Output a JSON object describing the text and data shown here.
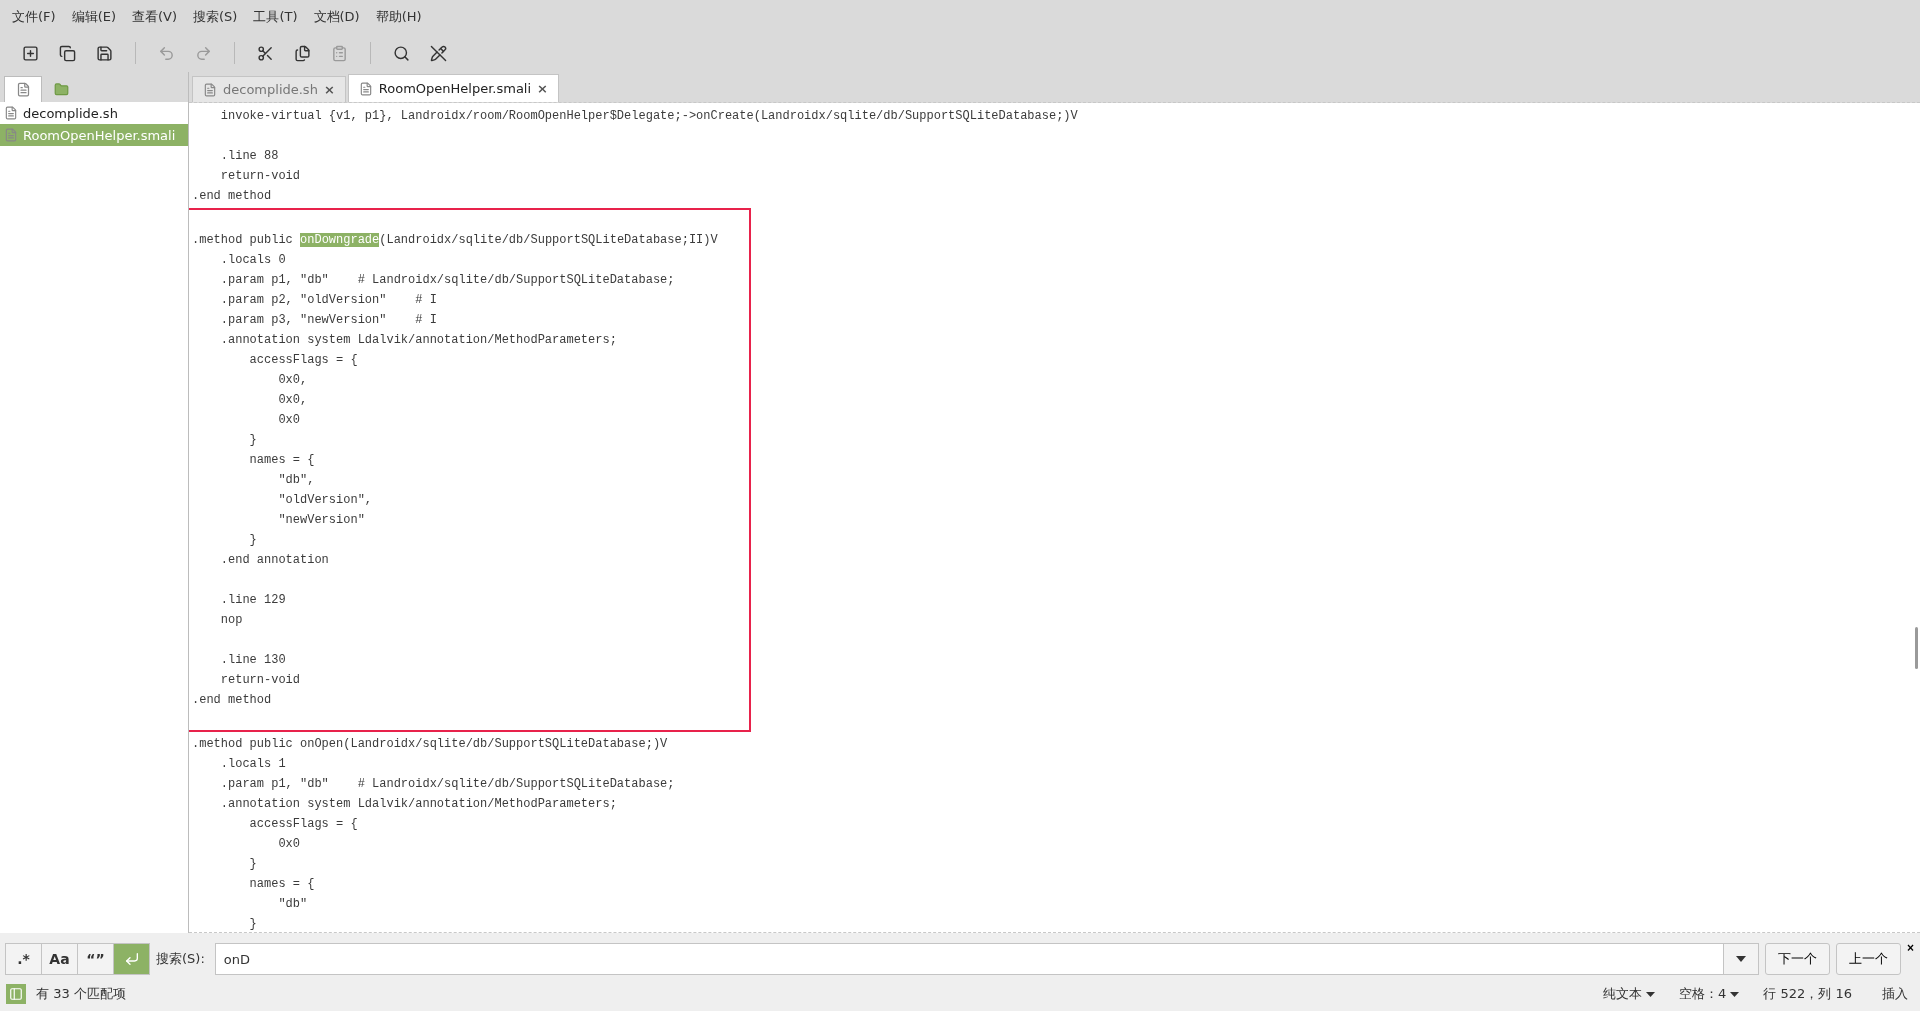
{
  "menu": [
    "文件(F)",
    "编辑(E)",
    "查看(V)",
    "搜索(S)",
    "工具(T)",
    "文档(D)",
    "帮助(H)"
  ],
  "toolbar": [
    {
      "kind": "new",
      "disabled": false
    },
    {
      "kind": "duplicate",
      "disabled": false
    },
    {
      "kind": "save",
      "disabled": false
    },
    {
      "kind": "separator"
    },
    {
      "kind": "undo",
      "disabled": true
    },
    {
      "kind": "redo",
      "disabled": true
    },
    {
      "kind": "separator"
    },
    {
      "kind": "cut",
      "disabled": false
    },
    {
      "kind": "copy",
      "disabled": false
    },
    {
      "kind": "paste",
      "disabled": true
    },
    {
      "kind": "separator"
    },
    {
      "kind": "search",
      "disabled": false
    },
    {
      "kind": "replace",
      "disabled": false
    }
  ],
  "side_tabs": [
    {
      "kind": "documents",
      "selected": true
    },
    {
      "kind": "folder",
      "selected": false
    }
  ],
  "files": [
    {
      "name": "decomplide.sh",
      "selected": false
    },
    {
      "name": "RoomOpenHelper.smali",
      "selected": true
    }
  ],
  "editor_tabs": [
    {
      "label": "decomplide.sh",
      "selected": false,
      "close": "×"
    },
    {
      "label": "RoomOpenHelper.smali",
      "selected": true,
      "close": "×"
    }
  ],
  "code_blocks": [
    {
      "framed": false,
      "lines": [
        {
          "kind": "code",
          "text": "    invoke-virtual {v1, p1}, Landroidx/room/RoomOpenHelper$Delegate;->onCreate(Landroidx/sqlite/db/SupportSQLiteDatabase;)V"
        },
        {
          "kind": "blank"
        },
        {
          "kind": "code",
          "text": "    .line 88"
        },
        {
          "kind": "code",
          "text": "    return-void"
        },
        {
          "kind": "code",
          "text": ".end method"
        }
      ]
    },
    {
      "framed": true,
      "lines": [
        {
          "kind": "blank"
        },
        {
          "kind": "match",
          "before": ".method public ",
          "match": "onDowngrade",
          "after": "(Landroidx/sqlite/db/SupportSQLiteDatabase;II)V"
        },
        {
          "kind": "code",
          "text": "    .locals 0"
        },
        {
          "kind": "code",
          "text": "    .param p1, \"db\"    # Landroidx/sqlite/db/SupportSQLiteDatabase;"
        },
        {
          "kind": "code",
          "text": "    .param p2, \"oldVersion\"    # I"
        },
        {
          "kind": "code",
          "text": "    .param p3, \"newVersion\"    # I"
        },
        {
          "kind": "code",
          "text": "    .annotation system Ldalvik/annotation/MethodParameters;"
        },
        {
          "kind": "code",
          "text": "        accessFlags = {"
        },
        {
          "kind": "code",
          "text": "            0x0,"
        },
        {
          "kind": "code",
          "text": "            0x0,"
        },
        {
          "kind": "code",
          "text": "            0x0"
        },
        {
          "kind": "code",
          "text": "        }"
        },
        {
          "kind": "code",
          "text": "        names = {"
        },
        {
          "kind": "code",
          "text": "            \"db\","
        },
        {
          "kind": "code",
          "text": "            \"oldVersion\","
        },
        {
          "kind": "code",
          "text": "            \"newVersion\""
        },
        {
          "kind": "code",
          "text": "        }"
        },
        {
          "kind": "code",
          "text": "    .end annotation"
        },
        {
          "kind": "blank"
        },
        {
          "kind": "code",
          "text": "    .line 129"
        },
        {
          "kind": "code",
          "text": "    nop"
        },
        {
          "kind": "blank"
        },
        {
          "kind": "code",
          "text": "    .line 130"
        },
        {
          "kind": "code",
          "text": "    return-void"
        },
        {
          "kind": "code",
          "text": ".end method"
        },
        {
          "kind": "blank"
        }
      ]
    },
    {
      "framed": false,
      "lines": [
        {
          "kind": "code",
          "text": ".method public onOpen(Landroidx/sqlite/db/SupportSQLiteDatabase;)V"
        },
        {
          "kind": "code",
          "text": "    .locals 1"
        },
        {
          "kind": "code",
          "text": "    .param p1, \"db\"    # Landroidx/sqlite/db/SupportSQLiteDatabase;"
        },
        {
          "kind": "code",
          "text": "    .annotation system Ldalvik/annotation/MethodParameters;"
        },
        {
          "kind": "code",
          "text": "        accessFlags = {"
        },
        {
          "kind": "code",
          "text": "            0x0"
        },
        {
          "kind": "code",
          "text": "        }"
        },
        {
          "kind": "code",
          "text": "        names = {"
        },
        {
          "kind": "code",
          "text": "            \"db\""
        },
        {
          "kind": "code",
          "text": "        }"
        }
      ]
    }
  ],
  "search": {
    "toggles": [
      {
        "label": ".*",
        "kind": "text",
        "selected": false
      },
      {
        "label": "Aa",
        "kind": "text",
        "selected": false
      },
      {
        "label": "“”",
        "kind": "text",
        "selected": false
      },
      {
        "kind": "wrap",
        "selected": true
      }
    ],
    "label": "搜索(S):",
    "value": "onD",
    "next": "下一个",
    "previous": "上一个",
    "close": "×"
  },
  "status": {
    "matches": "有 33 个匹配项",
    "language": "纯文本",
    "indent": "空格：4",
    "position": "行 522，列 16",
    "mode": "插入"
  }
}
